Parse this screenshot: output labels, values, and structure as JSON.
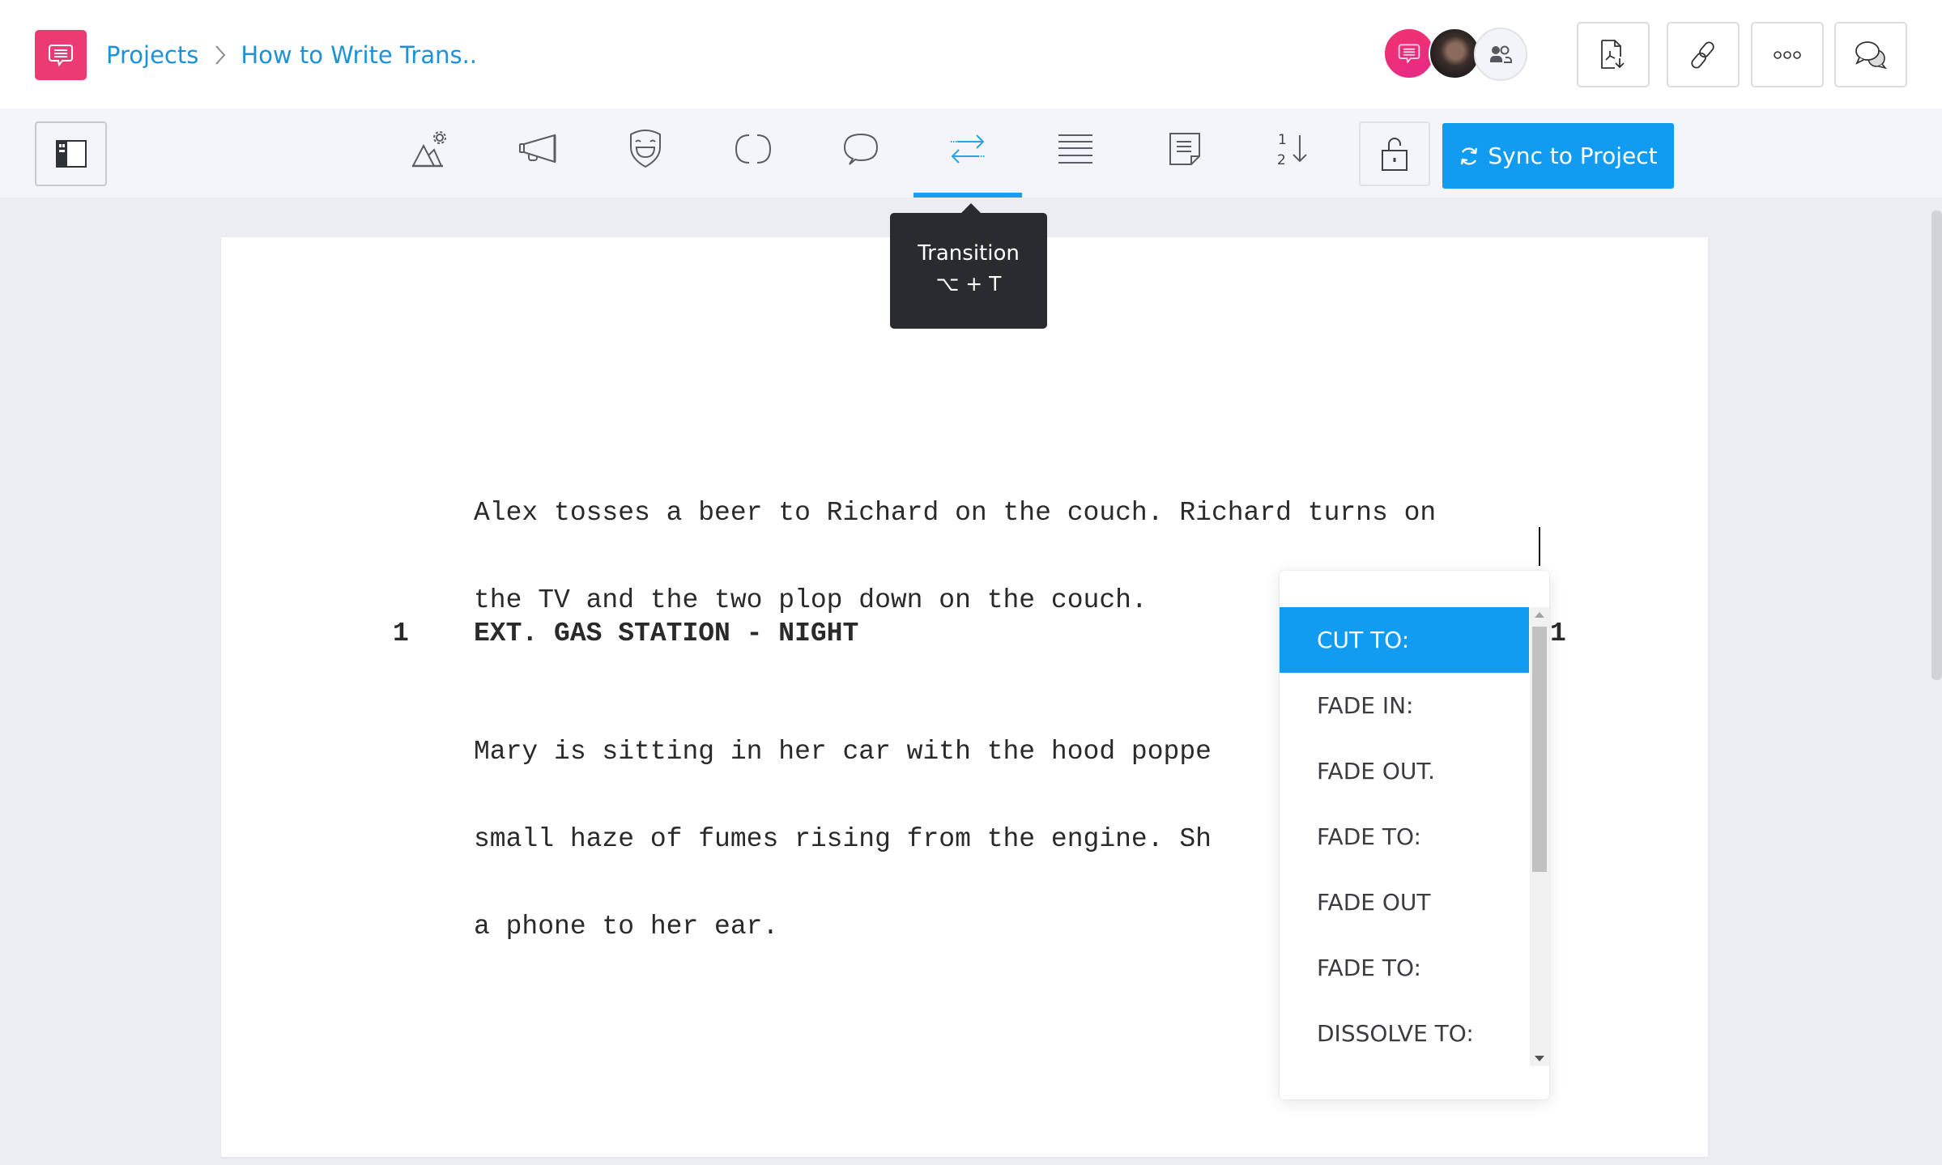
{
  "header": {
    "breadcrumb": {
      "root": "Projects",
      "current": "How to Write Trans.."
    },
    "collaborators": [
      {
        "type": "app-avatar"
      },
      {
        "type": "user-photo"
      },
      {
        "type": "add-collaborators"
      }
    ],
    "actions": [
      {
        "icon": "pdf-download-icon"
      },
      {
        "icon": "link-icon"
      },
      {
        "icon": "more-icon"
      },
      {
        "icon": "comments-icon"
      }
    ]
  },
  "toolbar": {
    "tools": [
      {
        "name": "scene-heading",
        "icon": "scene-mountains-icon"
      },
      {
        "name": "action",
        "icon": "megaphone-icon"
      },
      {
        "name": "character",
        "icon": "mask-icon"
      },
      {
        "name": "parenthetical",
        "icon": "parentheses-icon"
      },
      {
        "name": "dialogue",
        "icon": "speech-bubble-icon"
      },
      {
        "name": "transition",
        "icon": "transition-arrows-icon",
        "active": true
      },
      {
        "name": "general",
        "icon": "lines-icon"
      },
      {
        "name": "note",
        "icon": "note-icon"
      },
      {
        "name": "scene-numbering",
        "icon": "numbering-icon"
      }
    ],
    "sync_label": "Sync to Project",
    "accent_color": "#129cf1"
  },
  "tooltip": {
    "title": "Transition",
    "shortcut": "⌥ + T"
  },
  "script": {
    "action_1": [
      "Alex tosses a beer to Richard on the couch. Richard turns on",
      "the TV and the two plop down on the couch."
    ],
    "scene": {
      "number_left": "1",
      "heading": "EXT. GAS STATION - NIGHT",
      "number_right": "1"
    },
    "action_2": [
      "Mary is sitting in her car with the hood poppe",
      "small haze of fumes rising from the engine. Sh",
      "a phone to her ear."
    ]
  },
  "transition_dropdown": {
    "selected": "CUT TO:",
    "options": [
      "CUT TO:",
      "FADE IN:",
      "FADE OUT.",
      "FADE TO:",
      "FADE OUT",
      "FADE TO:",
      "DISSOLVE TO:"
    ]
  }
}
